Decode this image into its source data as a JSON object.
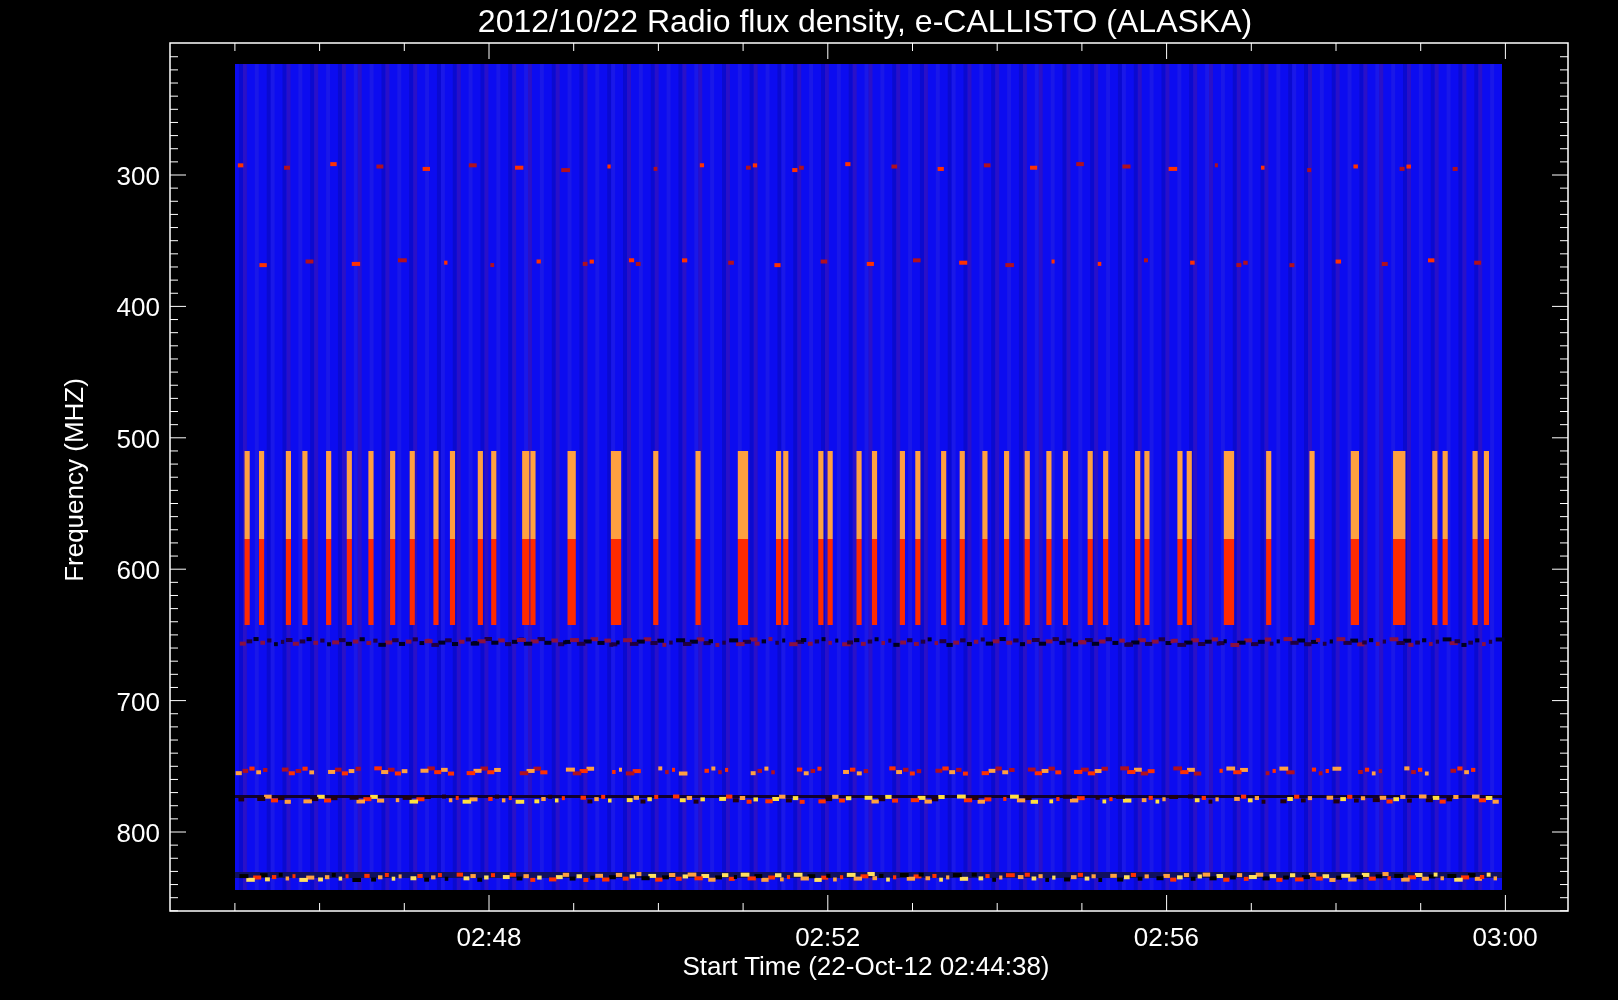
{
  "title": "2012/10/22  Radio flux density, e-CALLISTO (ALASKA)",
  "y_axis": {
    "label": "Frequency (MHZ)",
    "ticks": [
      "300",
      "400",
      "500",
      "600",
      "700",
      "800"
    ]
  },
  "x_axis": {
    "label": "Start Time (22-Oct-12 02:44:38)",
    "ticks": [
      "02:48",
      "02:52",
      "02:56",
      "03:00"
    ]
  }
}
